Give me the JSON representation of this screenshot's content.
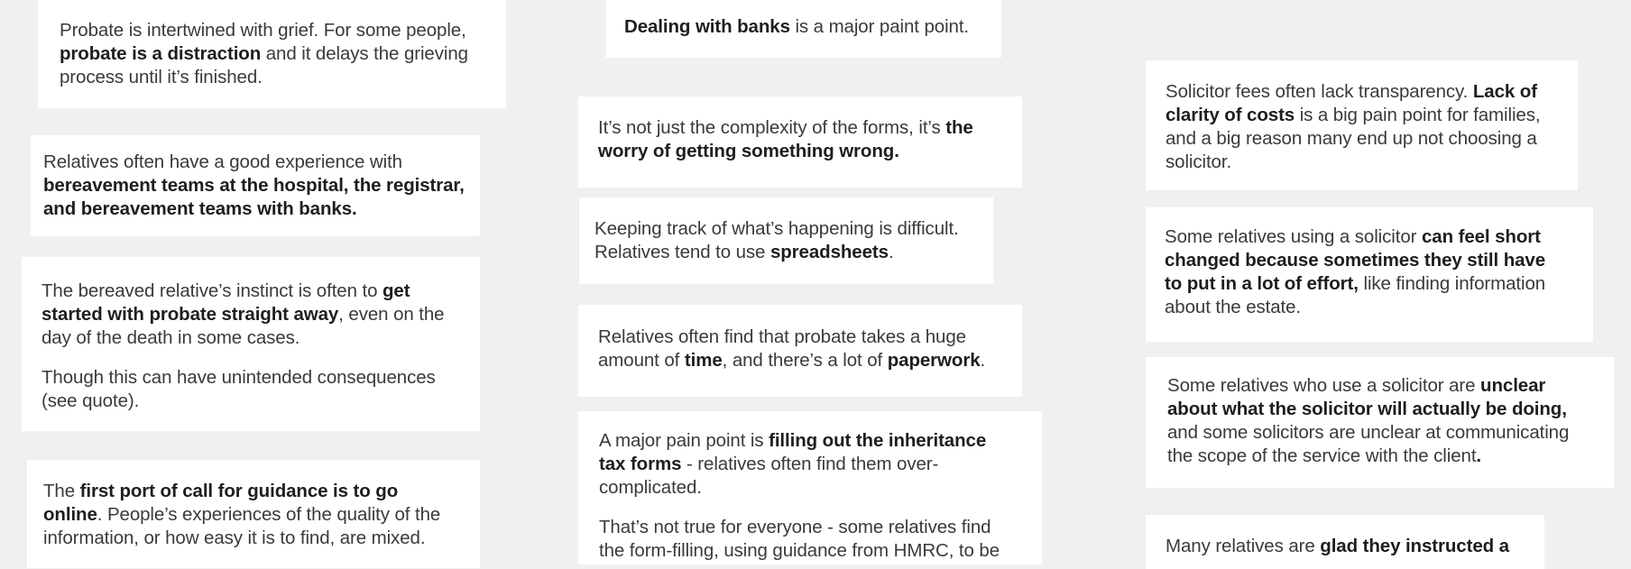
{
  "cards": [
    {
      "paragraphs": [
        [
          {
            "t": "Probate is intertwined with grief. For some people, "
          },
          {
            "t": "probate is a distraction",
            "b": true
          },
          {
            "t": " and it delays the grieving process until it’s finished."
          }
        ]
      ]
    },
    {
      "paragraphs": [
        [
          {
            "t": "Relatives often have a good experience with "
          },
          {
            "t": "bereavement teams at the hospital, the registrar, and bereavement teams with banks.",
            "b": true
          }
        ]
      ]
    },
    {
      "paragraphs": [
        [
          {
            "t": "The bereaved relative’s instinct is often to "
          },
          {
            "t": "get started with probate straight away",
            "b": true
          },
          {
            "t": ", even on the day of the death in some cases."
          }
        ],
        [
          {
            "t": "Though this can have unintended consequences (see quote)."
          }
        ]
      ]
    },
    {
      "paragraphs": [
        [
          {
            "t": "The "
          },
          {
            "t": "first port of call for guidance is to go online",
            "b": true
          },
          {
            "t": ". People’s experiences of the quality of the information, or how easy it is to find, are mixed."
          }
        ]
      ]
    },
    {
      "paragraphs": [
        [
          {
            "t": "Dealing with banks",
            "b": true
          },
          {
            "t": " is a major paint point."
          }
        ]
      ]
    },
    {
      "paragraphs": [
        [
          {
            "t": "It’s not just the complexity of the forms, it’s "
          },
          {
            "t": "the worry of getting something wrong.",
            "b": true
          }
        ]
      ]
    },
    {
      "paragraphs": [
        [
          {
            "t": "Keeping track of what’s happening is difficult. Relatives tend to use "
          },
          {
            "t": "spreadsheets",
            "b": true
          },
          {
            "t": "."
          }
        ]
      ]
    },
    {
      "paragraphs": [
        [
          {
            "t": "Relatives often find that probate takes a huge amount of "
          },
          {
            "t": "time",
            "b": true
          },
          {
            "t": ", and there’s a lot of "
          },
          {
            "t": "paperwork",
            "b": true
          },
          {
            "t": "."
          }
        ]
      ]
    },
    {
      "paragraphs": [
        [
          {
            "t": "A major pain point is "
          },
          {
            "t": "filling out the inheritance tax forms",
            "b": true
          },
          {
            "t": " - relatives often find them over-complicated."
          }
        ],
        [
          {
            "t": "That’s not true for everyone - some relatives find the form-filling, using guidance from HMRC, to be"
          }
        ]
      ]
    },
    {
      "paragraphs": [
        [
          {
            "t": "Solicitor fees often lack transparency. "
          },
          {
            "t": "Lack of clarity of costs",
            "b": true
          },
          {
            "t": " is a big pain point for families, and a big reason many end up not choosing a solicitor."
          }
        ]
      ]
    },
    {
      "paragraphs": [
        [
          {
            "t": "Some relatives using a solicitor "
          },
          {
            "t": "can feel short changed because sometimes they still have to put in a lot of effort,",
            "b": true
          },
          {
            "t": " like finding information about the estate."
          }
        ]
      ]
    },
    {
      "paragraphs": [
        [
          {
            "t": "Some relatives who use a solicitor are "
          },
          {
            "t": "unclear about what the solicitor will actually be doing,",
            "b": true
          },
          {
            "t": " and some solicitors are unclear at communicating the scope of the service with the client"
          },
          {
            "t": ".",
            "b": true
          }
        ]
      ]
    },
    {
      "paragraphs": [
        [
          {
            "t": "Many relatives are "
          },
          {
            "t": "glad they instructed a",
            "b": true
          }
        ]
      ]
    }
  ]
}
